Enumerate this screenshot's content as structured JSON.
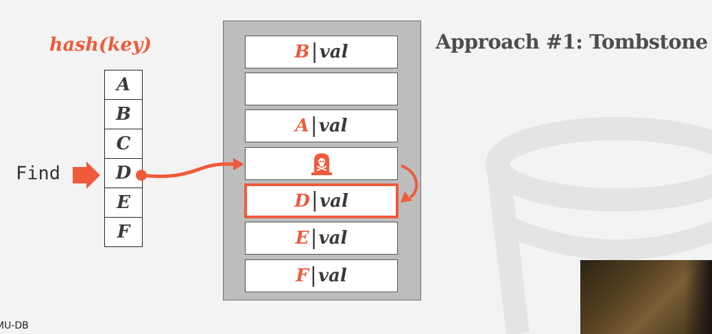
{
  "title": "Approach #1: Tombstone",
  "hash_label": "hash(key)",
  "find_label": "Find",
  "keys": [
    "A",
    "B",
    "C",
    "D",
    "E",
    "F"
  ],
  "slots": [
    {
      "key": "B",
      "sep": "|",
      "val": "val"
    },
    {
      "key": "",
      "sep": "",
      "val": ""
    },
    {
      "key": "A",
      "sep": "|",
      "val": "val"
    },
    {
      "key": "",
      "sep": "",
      "val": "",
      "tombstone": true
    },
    {
      "key": "D",
      "sep": "|",
      "val": "val",
      "highlighted": true
    },
    {
      "key": "E",
      "sep": "|",
      "val": "val"
    },
    {
      "key": "F",
      "sep": "|",
      "val": "val"
    }
  ],
  "footer": "MU-DB",
  "colors": {
    "accent": "#f05a3a",
    "text": "#4d4d4d",
    "table_bg": "#bdbdbd"
  }
}
